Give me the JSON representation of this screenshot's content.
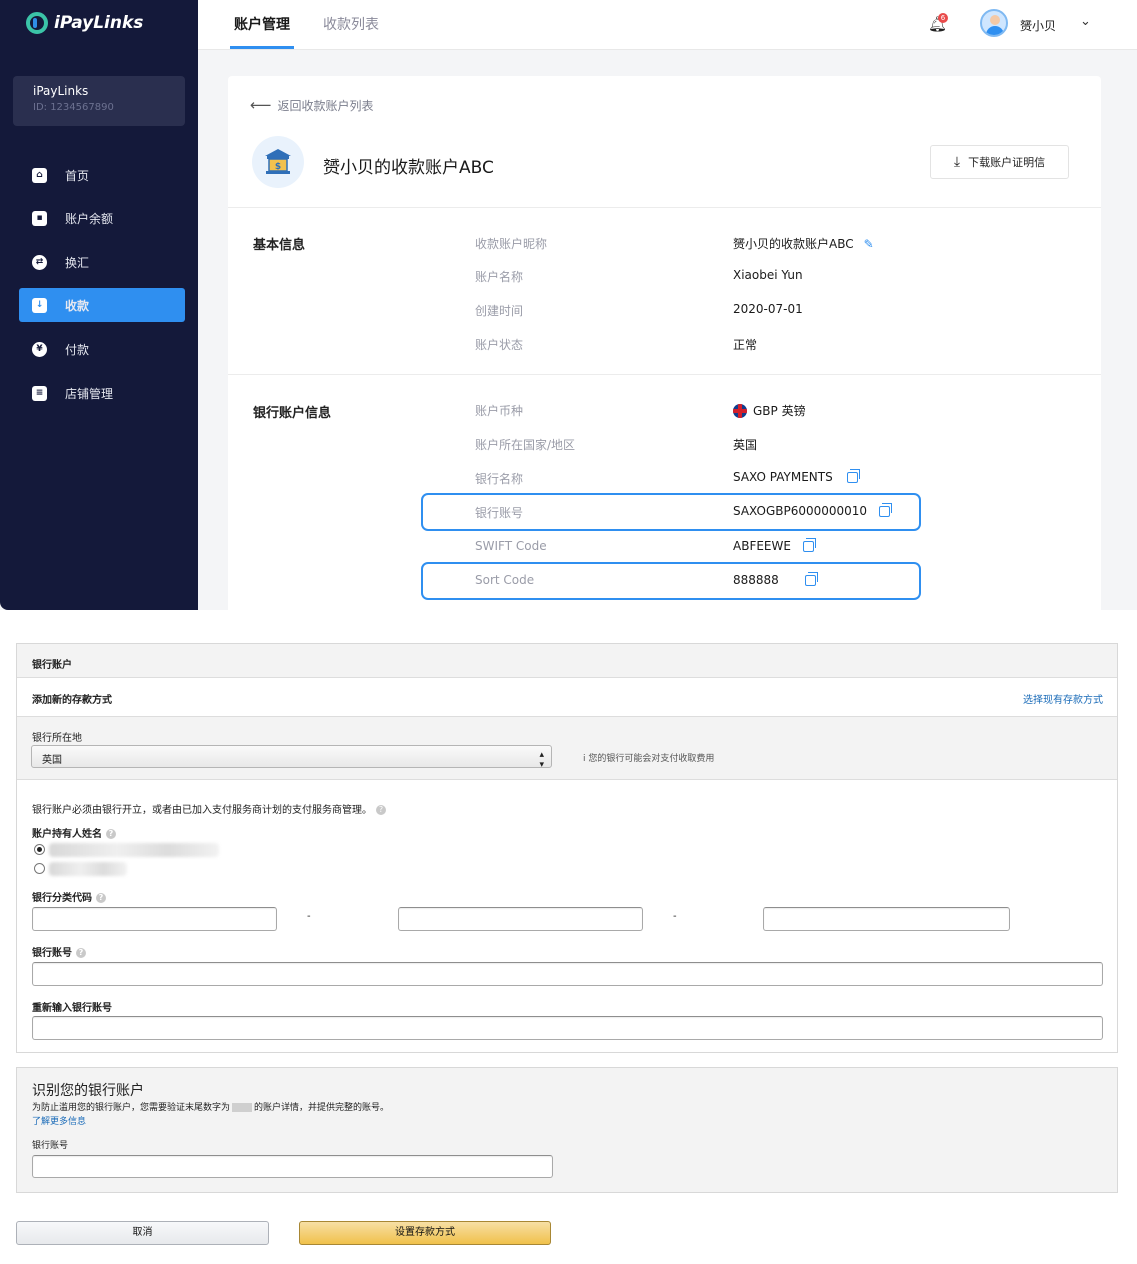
{
  "app": {
    "brand": "iPayLinks",
    "account_card": {
      "name": "iPayLinks",
      "id": "ID: 1234567890"
    },
    "nav": [
      {
        "label": "首页",
        "icon": "home-icon"
      },
      {
        "label": "账户余额",
        "icon": "wallet-icon"
      },
      {
        "label": "换汇",
        "icon": "exchange-icon"
      },
      {
        "label": "收款",
        "icon": "receive-icon",
        "active": true
      },
      {
        "label": "付款",
        "icon": "yuan-icon"
      },
      {
        "label": "店铺管理",
        "icon": "store-icon"
      }
    ],
    "tabs": [
      {
        "label": "账户管理",
        "active": true
      },
      {
        "label": "收款列表"
      }
    ],
    "notifications": "6",
    "user": "赟小贝",
    "accent_color": "#2f8ff0"
  },
  "detail": {
    "back_link": "返回收款账户列表",
    "title": "赟小贝的收款账户ABC",
    "download_button": "下载账户证明信",
    "basic": {
      "section_title": "基本信息",
      "rows": [
        {
          "label": "收款账户昵称",
          "value": "赟小贝的收款账户ABC"
        },
        {
          "label": "账户名称",
          "value": "Xiaobei Yun"
        },
        {
          "label": "创建时间",
          "value": "2020-07-01"
        },
        {
          "label": "账户状态",
          "value": "正常"
        }
      ]
    },
    "bank": {
      "section_title": "银行账户信息",
      "rows": [
        {
          "label": "账户币种",
          "value": "GBP 英镑"
        },
        {
          "label": "账户所在国家/地区",
          "value": "英国"
        },
        {
          "label": "银行名称",
          "value": "SAXO PAYMENTS"
        },
        {
          "label": "银行账号",
          "value": "SAXOGBP6000000010"
        },
        {
          "label": "SWIFT Code",
          "value": "ABFEEWE"
        },
        {
          "label": "Sort Code",
          "value": "888888"
        }
      ]
    }
  },
  "form": {
    "header": "银行账户",
    "add_method": "添加新的存款方式",
    "choose_existing": "选择现有存款方式",
    "country_label": "银行所在地",
    "country_value": "英国",
    "country_hint": "i 您的银行可能会对支付收取费用",
    "notice": "银行账户必须由银行开立，或者由已加入支付服务商计划的支付服务商管理。",
    "holder_label": "账户持有人姓名",
    "sort_label": "银行分类代码",
    "sort_dash": "-",
    "account_label": "银行账号",
    "reenter_label": "重新输入银行账号",
    "verify_title": "识别您的银行账户",
    "verify_desc": "为防止滥用您的银行账户，您需要验证末尾数字为",
    "verify_desc2": "的账户详情，并提供完整的账号。",
    "learn_more": "了解更多信息",
    "verify_field_label": "银行账号",
    "cancel_button": "取消",
    "save_button": "设置存款方式"
  }
}
